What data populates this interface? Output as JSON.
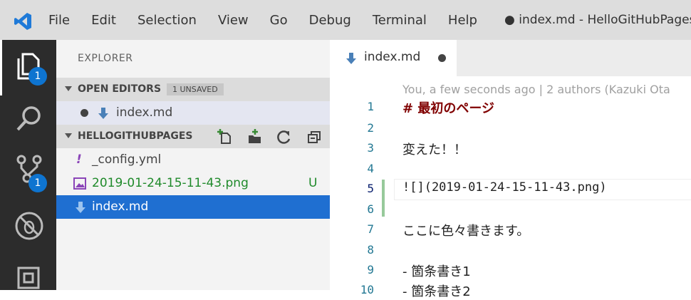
{
  "menu": [
    "File",
    "Edit",
    "Selection",
    "View",
    "Go",
    "Debug",
    "Terminal",
    "Help"
  ],
  "window_title": "● index.md - HelloGitHubPages -",
  "activity_bar": {
    "explorer_badge": "1",
    "scm_badge": "1",
    "icons": [
      "files-icon",
      "search-icon",
      "source-control-icon",
      "debug-icon",
      "extensions-icon"
    ]
  },
  "sidebar": {
    "title": "EXPLORER",
    "open_editors": {
      "label": "OPEN EDITORS",
      "badge": "1 UNSAVED",
      "items": [
        {
          "name": "index.md"
        }
      ]
    },
    "folder": {
      "label": "HELLOGITHUBPAGES",
      "files": [
        {
          "name": "_config.yml",
          "status": ""
        },
        {
          "name": "2019-01-24-15-11-43.png",
          "status": "U"
        },
        {
          "name": "index.md",
          "status": ""
        }
      ]
    }
  },
  "editor": {
    "tab": {
      "label": "index.md",
      "dirty": true
    },
    "blame": "You, a few seconds ago | 2 authors (Kazuki Ota",
    "lines": [
      {
        "n": "1",
        "text": "# 最初のページ"
      },
      {
        "n": "2",
        "text": ""
      },
      {
        "n": "3",
        "text": "変えた！！"
      },
      {
        "n": "4",
        "text": ""
      },
      {
        "n": "5",
        "text": "![](2019-01-24-15-11-43.png)"
      },
      {
        "n": "6",
        "text": ""
      },
      {
        "n": "7",
        "text": "ここに色々書きます。"
      },
      {
        "n": "8",
        "text": ""
      },
      {
        "n": "9",
        "text": "- 箇条書き1"
      },
      {
        "n": "10",
        "text": "- 箇条書き2"
      }
    ]
  },
  "colors": {
    "accent": "#1f6fd1",
    "badge": "#0e74d0",
    "untracked": "#1f8a2a",
    "heading": "#800000"
  }
}
